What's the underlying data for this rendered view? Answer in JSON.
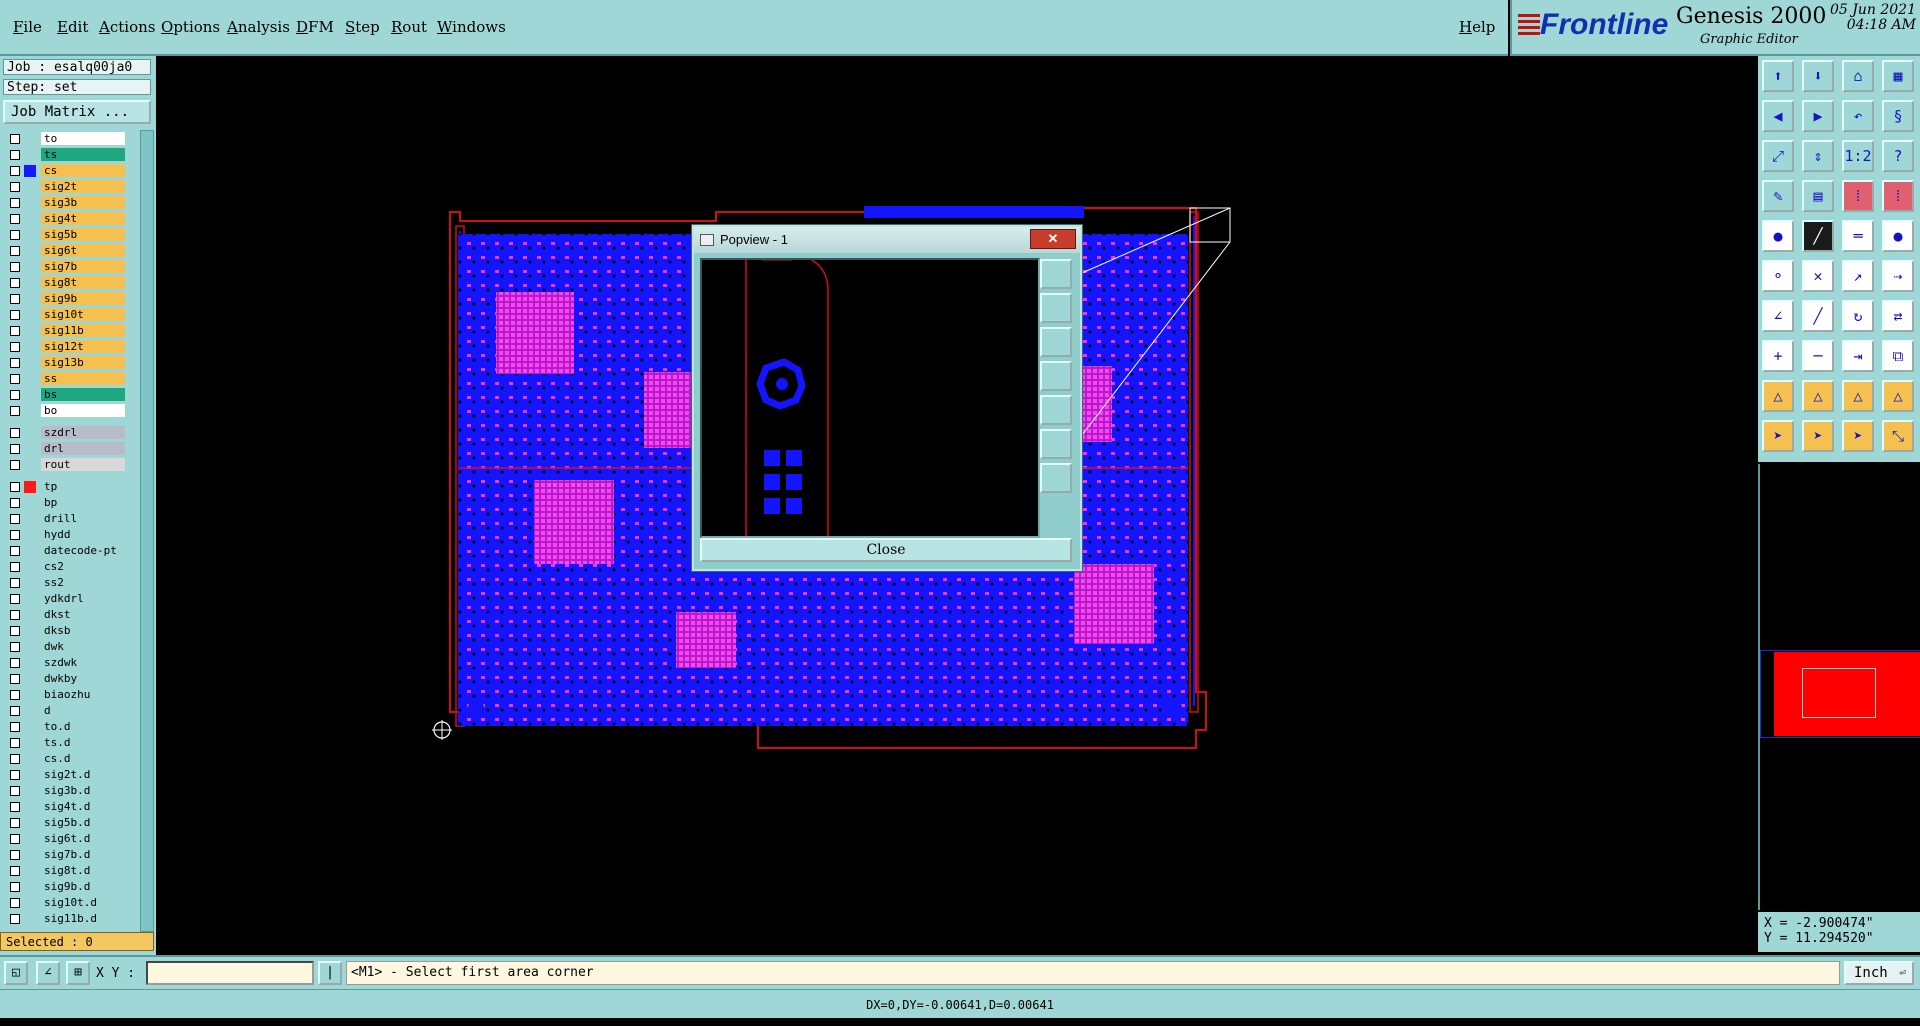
{
  "menu": {
    "items": [
      "File",
      "Edit",
      "Actions",
      "Options",
      "Analysis",
      "DFM",
      "Step",
      "Rout",
      "Windows"
    ],
    "help": "Help"
  },
  "branding": {
    "brand": "Frontline",
    "product": "Genesis 2000",
    "subtitle": "Graphic Editor",
    "date": "05 Jun 2021",
    "time": "04:18 AM"
  },
  "job": {
    "job_label": "Job : esalq00ja0",
    "step_label": "Step: set",
    "job_matrix_button": "Job Matrix ..."
  },
  "layers": [
    {
      "name": "to",
      "color": "#ffffff",
      "swatch": ""
    },
    {
      "name": "ts",
      "color": "#1ea882",
      "swatch": ""
    },
    {
      "name": "cs",
      "color": "#f4c050",
      "swatch": "#1818ff"
    },
    {
      "name": "sig2t",
      "color": "#f4c050",
      "swatch": ""
    },
    {
      "name": "sig3b",
      "color": "#f4c050",
      "swatch": ""
    },
    {
      "name": "sig4t",
      "color": "#f4c050",
      "swatch": ""
    },
    {
      "name": "sig5b",
      "color": "#f4c050",
      "swatch": ""
    },
    {
      "name": "sig6t",
      "color": "#f4c050",
      "swatch": ""
    },
    {
      "name": "sig7b",
      "color": "#f4c050",
      "swatch": ""
    },
    {
      "name": "sig8t",
      "color": "#f4c050",
      "swatch": ""
    },
    {
      "name": "sig9b",
      "color": "#f4c050",
      "swatch": ""
    },
    {
      "name": "sig10t",
      "color": "#f4c050",
      "swatch": ""
    },
    {
      "name": "sig11b",
      "color": "#f4c050",
      "swatch": ""
    },
    {
      "name": "sig12t",
      "color": "#f4c050",
      "swatch": ""
    },
    {
      "name": "sig13b",
      "color": "#f4c050",
      "swatch": ""
    },
    {
      "name": "ss",
      "color": "#f4c050",
      "swatch": ""
    },
    {
      "name": "bs",
      "color": "#1ea882",
      "swatch": ""
    },
    {
      "name": "bo",
      "color": "#ffffff",
      "swatch": ""
    },
    {
      "name": "szdrl",
      "color": "#b8bcc8",
      "swatch": ""
    },
    {
      "name": "drl",
      "color": "#b8bcc8",
      "swatch": ""
    },
    {
      "name": "rout",
      "color": "#d8d8d8",
      "swatch": ""
    },
    {
      "name": "tp",
      "color": "#9fd6d6",
      "swatch": "#ff1818"
    },
    {
      "name": "bp",
      "color": "#9fd6d6",
      "swatch": ""
    },
    {
      "name": "drill",
      "color": "#9fd6d6",
      "swatch": ""
    },
    {
      "name": "hydd",
      "color": "#9fd6d6",
      "swatch": ""
    },
    {
      "name": "datecode-pt",
      "color": "#9fd6d6",
      "swatch": ""
    },
    {
      "name": "cs2",
      "color": "#9fd6d6",
      "swatch": ""
    },
    {
      "name": "ss2",
      "color": "#9fd6d6",
      "swatch": ""
    },
    {
      "name": "ydkdrl",
      "color": "#9fd6d6",
      "swatch": ""
    },
    {
      "name": "dkst",
      "color": "#9fd6d6",
      "swatch": ""
    },
    {
      "name": "dksb",
      "color": "#9fd6d6",
      "swatch": ""
    },
    {
      "name": "dwk",
      "color": "#9fd6d6",
      "swatch": ""
    },
    {
      "name": "szdwk",
      "color": "#9fd6d6",
      "swatch": ""
    },
    {
      "name": "dwkby",
      "color": "#9fd6d6",
      "swatch": ""
    },
    {
      "name": "biaozhu",
      "color": "#9fd6d6",
      "swatch": ""
    },
    {
      "name": "d",
      "color": "#9fd6d6",
      "swatch": ""
    },
    {
      "name": "to.d",
      "color": "#9fd6d6",
      "swatch": ""
    },
    {
      "name": "ts.d",
      "color": "#9fd6d6",
      "swatch": ""
    },
    {
      "name": "cs.d",
      "color": "#9fd6d6",
      "swatch": ""
    },
    {
      "name": "sig2t.d",
      "color": "#9fd6d6",
      "swatch": ""
    },
    {
      "name": "sig3b.d",
      "color": "#9fd6d6",
      "swatch": ""
    },
    {
      "name": "sig4t.d",
      "color": "#9fd6d6",
      "swatch": ""
    },
    {
      "name": "sig5b.d",
      "color": "#9fd6d6",
      "swatch": ""
    },
    {
      "name": "sig6t.d",
      "color": "#9fd6d6",
      "swatch": ""
    },
    {
      "name": "sig7b.d",
      "color": "#9fd6d6",
      "swatch": ""
    },
    {
      "name": "sig8t.d",
      "color": "#9fd6d6",
      "swatch": ""
    },
    {
      "name": "sig9b.d",
      "color": "#9fd6d6",
      "swatch": ""
    },
    {
      "name": "sig10t.d",
      "color": "#9fd6d6",
      "swatch": ""
    },
    {
      "name": "sig11b.d",
      "color": "#9fd6d6",
      "swatch": ""
    }
  ],
  "selected_label": "Selected : 0",
  "popup": {
    "title": "Popview - 1",
    "close_button": "Close",
    "close_x": "✕"
  },
  "coordinates": {
    "x": "X = -2.900474\"",
    "y": "Y = 11.294520\""
  },
  "bottom": {
    "xy_label": "X Y :",
    "xy_value": "",
    "prompt": "<M1> - Select first area corner",
    "unit": "Inch"
  },
  "status": "DX=0,DY=-0.00641,D=0.00641",
  "toolbar_icons": [
    "open-icon",
    "save-icon",
    "home-icon",
    "grid-icon",
    "prev-icon",
    "next-icon",
    "undo-icon",
    "snap-icon",
    "zoom-fit-icon",
    "zoom-in-icon",
    "zoom-1to2-icon",
    "help-icon",
    "measure-icon",
    "grid-toggle-icon",
    "layers-icon",
    "panel-icon",
    "pad-icon",
    "line-icon",
    "ruler-icon",
    "circle-icon",
    "connect-icon",
    "delete-icon",
    "route-icon",
    "split-icon",
    "angle-icon",
    "slash-icon",
    "rotate-icon",
    "flip-icon",
    "add-icon",
    "minus-icon",
    "stretch-icon",
    "copy-icon",
    "arc-icon",
    "arc2-icon",
    "arc3-icon",
    "arc4-icon",
    "pointer-icon",
    "select-icon",
    "select2-icon",
    "multi-select-icon"
  ]
}
